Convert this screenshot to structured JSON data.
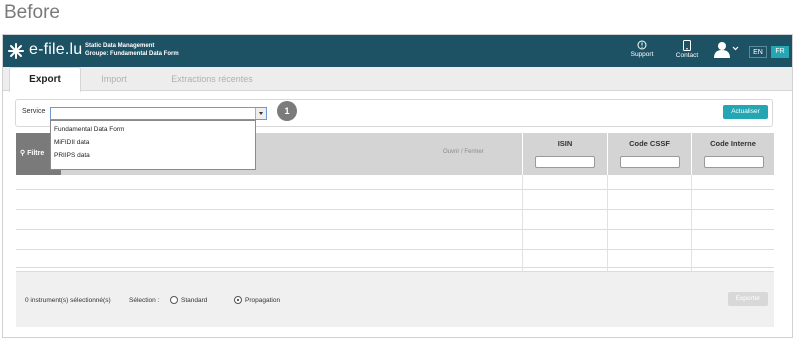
{
  "caption": "Before",
  "header": {
    "logo_text": "e-file.lu",
    "app_title_line1": "Static Data Management",
    "app_title_line2": "Groupe: Fundamental Data Form",
    "support_label": "Support",
    "contact_label": "Contact",
    "lang_en": "EN",
    "lang_fr": "FR",
    "accent_color": "#1d5265",
    "active_lang_color": "#24a6b3"
  },
  "tabs": [
    {
      "label": "Export",
      "active": true
    },
    {
      "label": "Import",
      "active": false
    },
    {
      "label": "Extractions récentes",
      "active": false
    }
  ],
  "service": {
    "label": "Service",
    "value": "",
    "options": [
      "Fundamental Data Form",
      "MiFIDII data",
      "PRIIPS data"
    ],
    "step_badge": "1",
    "refresh_label": "Actualiser"
  },
  "table": {
    "filter_label": "Filtre",
    "toggle_label": "Ouvrir / Fermer",
    "columns": [
      "ISIN",
      "Code CSSF",
      "Code Interne"
    ],
    "rows": []
  },
  "footer": {
    "selected_count": "0 instrument(s) sélectionné(s)",
    "selection_label": "Sélection :",
    "option_standard": "Standard",
    "option_propagation": "Propagation",
    "selected_option": "Propagation",
    "export_label": "Exporter"
  }
}
